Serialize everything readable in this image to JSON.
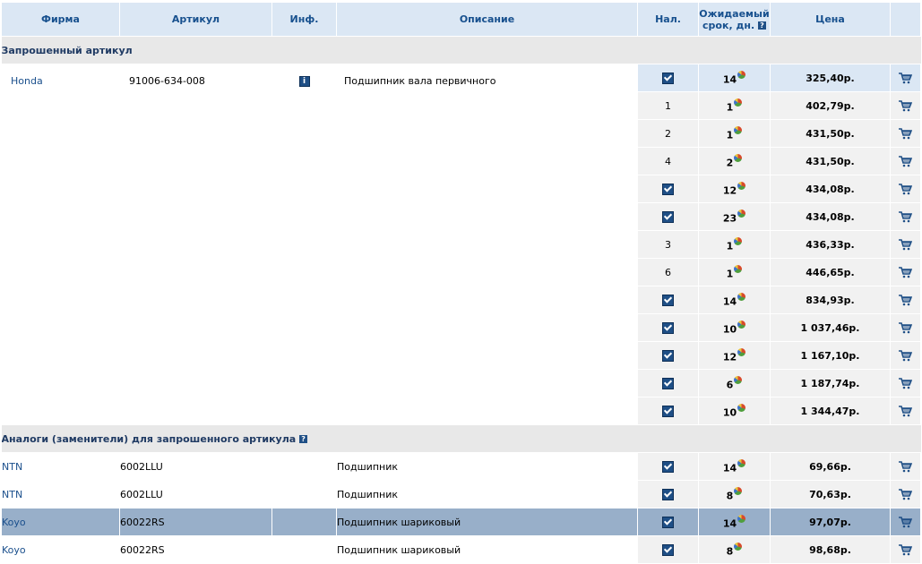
{
  "columns": {
    "firm": "Фирма",
    "article": "Артикул",
    "info": "Инф.",
    "description": "Описание",
    "availability": "Нал.",
    "days_line1": "Ожидаемый",
    "days_line2": "срок, дн.",
    "price": "Цена"
  },
  "requested_section": {
    "title": "Запрошенный артикул",
    "firm": "Honda",
    "article": "91006-634-008",
    "description": "Подшипник вала первичного",
    "offers": [
      {
        "availability": "checked",
        "days": "14",
        "price": "325,40р."
      },
      {
        "availability": "1",
        "days": "1",
        "price": "402,79р."
      },
      {
        "availability": "2",
        "days": "1",
        "price": "431,50р."
      },
      {
        "availability": "4",
        "days": "2",
        "price": "431,50р."
      },
      {
        "availability": "checked",
        "days": "12",
        "price": "434,08р."
      },
      {
        "availability": "checked",
        "days": "23",
        "price": "434,08р."
      },
      {
        "availability": "3",
        "days": "1",
        "price": "436,33р."
      },
      {
        "availability": "6",
        "days": "1",
        "price": "446,65р."
      },
      {
        "availability": "checked",
        "days": "14",
        "price": "834,93р."
      },
      {
        "availability": "checked",
        "days": "10",
        "price": "1 037,46р."
      },
      {
        "availability": "checked",
        "days": "12",
        "price": "1 167,10р."
      },
      {
        "availability": "checked",
        "days": "6",
        "price": "1 187,74р."
      },
      {
        "availability": "checked",
        "days": "10",
        "price": "1 344,47р."
      }
    ]
  },
  "analogs_section": {
    "title": "Аналоги (заменители) для запрошенного артикула",
    "rows": [
      {
        "firm": "NTN",
        "article": "6002LLU",
        "description": "Подшипник",
        "availability": "checked",
        "days": "14",
        "price": "69,66р.",
        "selected": false
      },
      {
        "firm": "NTN",
        "article": "6002LLU",
        "description": "Подшипник",
        "availability": "checked",
        "days": "8",
        "price": "70,63р.",
        "selected": false
      },
      {
        "firm": "Koyo",
        "article": "60022RS",
        "description": "Подшипник шариковый",
        "availability": "checked",
        "days": "14",
        "price": "97,07р.",
        "selected": true
      },
      {
        "firm": "Koyo",
        "article": "60022RS",
        "description": "Подшипник шариковый",
        "availability": "checked",
        "days": "8",
        "price": "98,68р.",
        "selected": false
      }
    ]
  },
  "icons": {
    "info": "info-icon",
    "cart": "cart-icon",
    "pie": "delivery-stats-icon",
    "help": "help-icon",
    "checkbox": "in-stock-checkbox"
  },
  "colors": {
    "header_bg": "#dbe7f4",
    "header_text": "#17508e",
    "section_bg": "#e8e8e8",
    "cell_bg": "#f1f1f1",
    "selected_row_bg": "#98afc9",
    "link": "#1a4f8c"
  }
}
